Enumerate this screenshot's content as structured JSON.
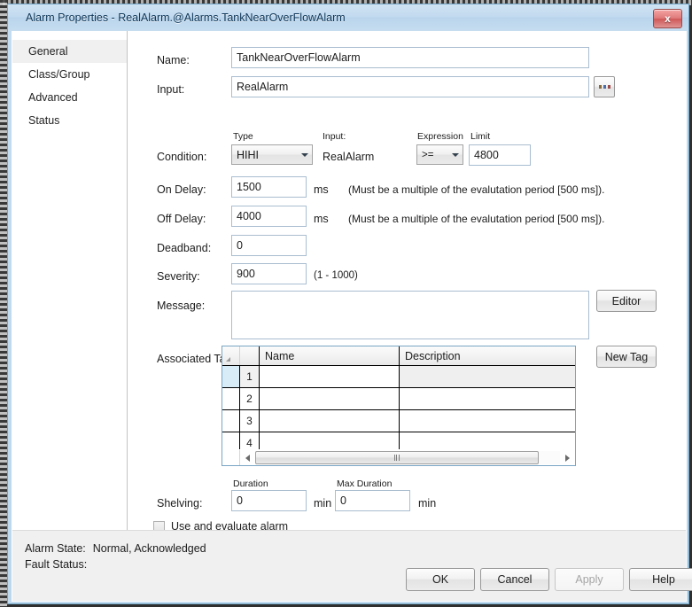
{
  "window": {
    "title": "Alarm Properties - RealAlarm.@Alarms.TankNearOverFlowAlarm",
    "close_glyph": "x",
    "close_icon": "close-icon"
  },
  "sidebar": {
    "items": [
      {
        "label": "General",
        "selected": true
      },
      {
        "label": "Class/Group",
        "selected": false
      },
      {
        "label": "Advanced",
        "selected": false
      },
      {
        "label": "Status",
        "selected": false
      }
    ]
  },
  "form": {
    "name": {
      "label": "Name:",
      "value": "TankNearOverFlowAlarm"
    },
    "input": {
      "label": "Input:",
      "value": "RealAlarm",
      "browse_label": "..."
    },
    "condition": {
      "label": "Condition:",
      "type_label": "Type",
      "type_value": "HIHI",
      "input_label": "Input:",
      "input_value": "RealAlarm",
      "expression_label": "Expression",
      "expression_value": ">=",
      "limit_label": "Limit",
      "limit_value": "4800"
    },
    "on_delay": {
      "label": "On Delay:",
      "value": "1500",
      "unit": "ms",
      "hint": "(Must be a multiple of the evalutation period [500 ms])."
    },
    "off_delay": {
      "label": "Off Delay:",
      "value": "4000",
      "unit": "ms",
      "hint": "(Must be a multiple of the evalutation period [500 ms])."
    },
    "deadband": {
      "label": "Deadband:",
      "value": "0"
    },
    "severity": {
      "label": "Severity:",
      "value": "900",
      "range_hint": "(1 - 1000)"
    },
    "message": {
      "label": "Message:",
      "value": "",
      "editor_label": "Editor"
    },
    "associated_tags": {
      "label": "Associated Tags:",
      "new_tag_label": "New Tag",
      "columns": [
        "Name",
        "Description"
      ],
      "rows": [
        {
          "num": "1",
          "name": "",
          "description": "",
          "selected": true
        },
        {
          "num": "2",
          "name": "",
          "description": "",
          "selected": false
        },
        {
          "num": "3",
          "name": "",
          "description": "",
          "selected": false
        },
        {
          "num": "4",
          "name": "",
          "description": "",
          "selected": false
        }
      ]
    },
    "shelving": {
      "label": "Shelving:",
      "duration_label": "Duration",
      "duration_value": "0",
      "duration_unit": "min",
      "max_duration_label": "Max Duration",
      "max_duration_value": "0",
      "max_duration_unit": "min"
    },
    "use_and_evaluate": {
      "label": "Use and evaluate alarm",
      "checked": false
    }
  },
  "status": {
    "alarm_state_label": "Alarm State:",
    "alarm_state_value": "Normal, Acknowledged",
    "fault_status_label": "Fault Status:",
    "fault_status_value": ""
  },
  "buttons": {
    "ok": "OK",
    "cancel": "Cancel",
    "apply": "Apply",
    "apply_disabled": true,
    "help": "Help"
  },
  "colors": {
    "titlebar": "#c2daef",
    "window_border": "#6ea2c4",
    "close_red": "#cf5858",
    "field_border": "#a9bdd0",
    "grid_border": "#7aa5c4",
    "row_selected": "#d8ecf8",
    "status_bg": "#f0f0f0"
  }
}
